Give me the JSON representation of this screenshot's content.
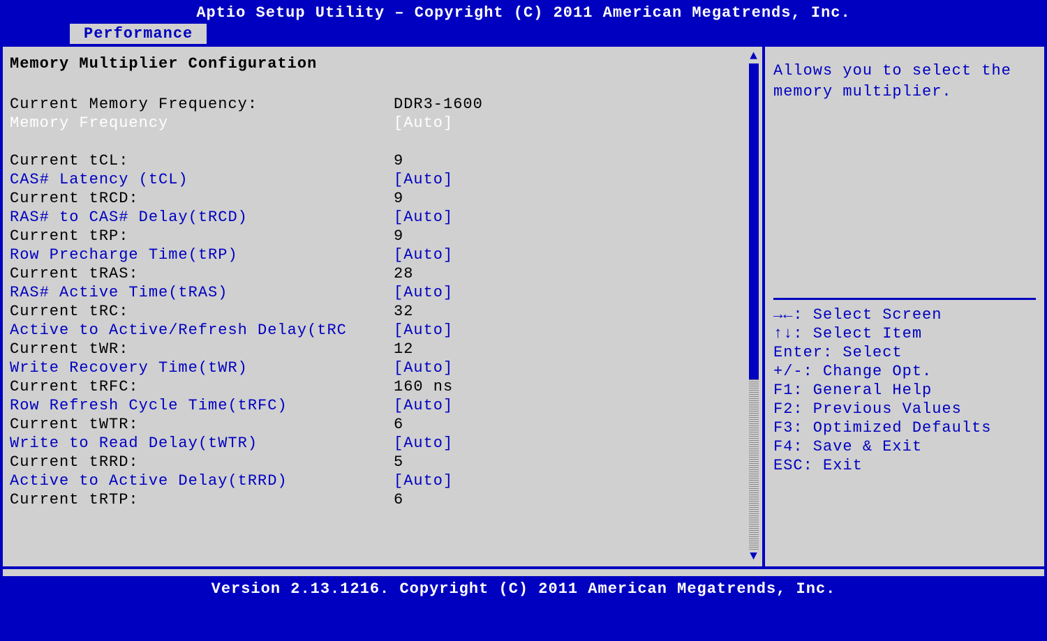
{
  "header": {
    "title": "Aptio Setup Utility – Copyright (C) 2011 American Megatrends, Inc."
  },
  "tabs": {
    "active": "Performance"
  },
  "section_title": "Memory Multiplier Configuration",
  "items": [
    {
      "type": "static",
      "label": "Current Memory Frequency:",
      "value": "DDR3-1600"
    },
    {
      "type": "selected",
      "label": "Memory Frequency",
      "value": "[Auto]"
    },
    {
      "type": "spacer"
    },
    {
      "type": "static",
      "label": "Current tCL:",
      "value": "9"
    },
    {
      "type": "option",
      "label": "CAS# Latency (tCL)",
      "value": "[Auto]"
    },
    {
      "type": "static",
      "label": "Current tRCD:",
      "value": "9"
    },
    {
      "type": "option",
      "label": "RAS# to CAS# Delay(tRCD)",
      "value": "[Auto]"
    },
    {
      "type": "static",
      "label": "Current tRP:",
      "value": "9"
    },
    {
      "type": "option",
      "label": "Row Precharge Time(tRP)",
      "value": "[Auto]"
    },
    {
      "type": "static",
      "label": "Current tRAS:",
      "value": "28"
    },
    {
      "type": "option",
      "label": "RAS# Active Time(tRAS)",
      "value": "[Auto]"
    },
    {
      "type": "static",
      "label": "Current tRC:",
      "value": "32"
    },
    {
      "type": "option",
      "label": "Active to Active/Refresh Delay(tRC",
      "value": "[Auto]"
    },
    {
      "type": "static",
      "label": "Current tWR:",
      "value": "12"
    },
    {
      "type": "option",
      "label": "Write Recovery Time(tWR)",
      "value": "[Auto]"
    },
    {
      "type": "static",
      "label": "Current tRFC:",
      "value": "160 ns"
    },
    {
      "type": "option",
      "label": "Row Refresh Cycle Time(tRFC)",
      "value": "[Auto]"
    },
    {
      "type": "static",
      "label": "Current tWTR:",
      "value": "6"
    },
    {
      "type": "option",
      "label": "Write to Read Delay(tWTR)",
      "value": "[Auto]"
    },
    {
      "type": "static",
      "label": "Current tRRD:",
      "value": "5"
    },
    {
      "type": "option",
      "label": "Active to Active Delay(tRRD)",
      "value": "[Auto]"
    },
    {
      "type": "static",
      "label": "Current tRTP:",
      "value": "6"
    }
  ],
  "help": {
    "description": "Allows you to select the memory multiplier."
  },
  "hints": [
    "→←: Select Screen",
    "↑↓: Select Item",
    "Enter: Select",
    "+/-: Change Opt.",
    "F1: General Help",
    "F2: Previous Values",
    "F3: Optimized Defaults",
    "F4: Save & Exit",
    "ESC: Exit"
  ],
  "footer": {
    "text": "Version 2.13.1216. Copyright (C) 2011 American Megatrends, Inc."
  }
}
